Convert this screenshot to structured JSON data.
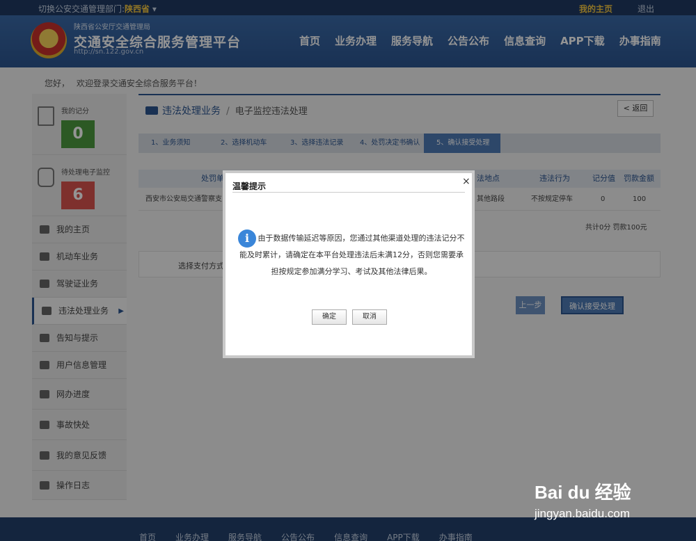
{
  "topbar": {
    "region_label": "切换公安交通管理部门:",
    "region_value": "陕西省",
    "home": "我的主页",
    "logout": "退出"
  },
  "header": {
    "org": "陕西省公安厅交通管理局",
    "title": "交通安全综合服务管理平台",
    "url": "http://sn.122.gov.cn",
    "nav": [
      "首页",
      "业务办理",
      "服务导航",
      "公告公布",
      "信息查询",
      "APP下载",
      "办事指南"
    ]
  },
  "welcome": "您好，　 欢迎登录交通安全综合服务平台！",
  "sidebar": {
    "stats": [
      {
        "label": "我的记分",
        "value": "0",
        "color": "#4c9a3e"
      },
      {
        "label": "待处理电子监控",
        "value": "6",
        "color": "#d9534f"
      }
    ],
    "menu": [
      {
        "label": "我的主页"
      },
      {
        "label": "机动车业务"
      },
      {
        "label": "驾驶证业务"
      },
      {
        "label": "违法处理业务"
      },
      {
        "label": "告知与提示"
      },
      {
        "label": "用户信息管理"
      },
      {
        "label": "网办进度"
      },
      {
        "label": "事故快处"
      },
      {
        "label": "我的意见反馈"
      },
      {
        "label": "操作日志"
      }
    ]
  },
  "main": {
    "breadcrumb": {
      "section": "违法处理业务",
      "sep": "/",
      "page": "电子监控违法处理"
    },
    "back": "< 返回",
    "steps": [
      "1、业务须知",
      "2、选择机动车",
      "3、选择违法记录",
      "4、处罚决定书确认",
      "5、确认接受处理"
    ],
    "table": {
      "headers": [
        "处罚单",
        "法地点",
        "违法行为",
        "记分值",
        "罚款金额"
      ],
      "row": [
        "西安市公安局交通警察支",
        "其他路段",
        "不按规定停车",
        "0",
        "100"
      ]
    },
    "totals": "共计0分 罚款100元",
    "pay_label": "选择支付方式",
    "prev": "上一步",
    "confirm": "确认接受处理"
  },
  "footer": {
    "nav": [
      "首页",
      "业务办理",
      "服务导航",
      "公告公布",
      "信息查询",
      "APP下载",
      "办事指南"
    ]
  },
  "modal": {
    "title": "温馨提示",
    "close": "×",
    "info_icon": "i",
    "message": "由于数据传输延迟等原因，您通过其他渠道处理的违法记分不能及时累计，请确定在本平台处理违法后未满12分，否则您需要承担按规定参加满分学习、考试及其他法律后果。",
    "ok": "确定",
    "cancel": "取消"
  },
  "watermark": {
    "brand": "Bai du 经验",
    "url": "jingyan.baidu.com"
  }
}
